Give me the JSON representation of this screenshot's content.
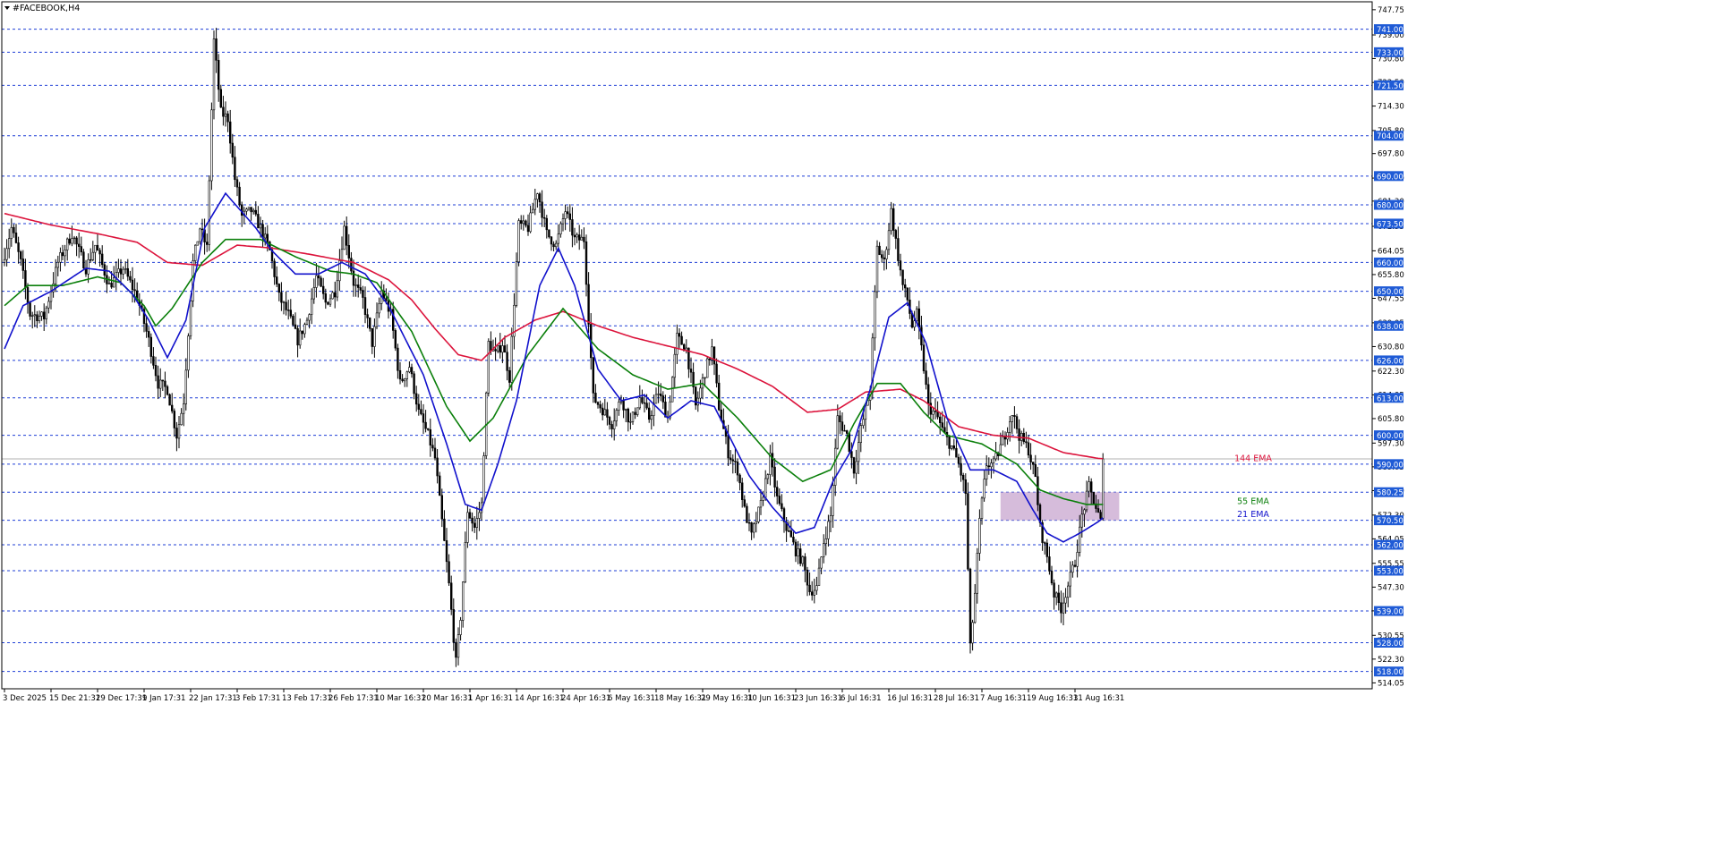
{
  "window": {
    "title": "#FACEBOOK,H4",
    "menu_icon": "triangle-down-icon"
  },
  "colors": {
    "background": "#ffffff",
    "frame": "#000000",
    "grid_level": "#1f3fd6",
    "candle": "#000000",
    "ema144": "#dc143c",
    "ema55": "#0a7f0a",
    "ema21": "#1111cc",
    "zone_fill": "#c8a6cf",
    "price_label_bg": "#1f5bd6",
    "price_label_text": "#ffffff",
    "axis_text": "#000000",
    "bid_line": "#b0b0b0"
  },
  "chart_data": {
    "type": "candlestick",
    "symbol": "#FACEBOOK",
    "timeframe": "H4",
    "ylim": [
      512.0,
      750.5
    ],
    "y_ticks": [
      "747.75",
      "739.00",
      "730.80",
      "722.50",
      "714.30",
      "705.80",
      "697.80",
      "689.30",
      "681.30",
      "672.55",
      "664.05",
      "655.80",
      "647.55",
      "639.05",
      "630.80",
      "622.30",
      "614.05",
      "605.80",
      "597.30",
      "589.05",
      "580.80",
      "572.30",
      "564.05",
      "555.55",
      "547.30",
      "539.05",
      "530.55",
      "522.30",
      "514.05"
    ],
    "x_labels": [
      "3 Dec 2025",
      "15 Dec 21:31",
      "29 Dec 17:31",
      "9 Jan 17:31",
      "22 Jan 17:31",
      "3 Feb 17:31",
      "13 Feb 17:31",
      "26 Feb 17:31",
      "10 Mar 16:31",
      "20 Mar 16:31",
      "1 Apr 16:31",
      "14 Apr 16:31",
      "24 Apr 16:31",
      "6 May 16:31",
      "18 May 16:31",
      "29 May 16:31",
      "10 Jun 16:31",
      "23 Jun 16:31",
      "6 Jul 16:31",
      "16 Jul 16:31",
      "28 Jul 16:31",
      "7 Aug 16:31",
      "19 Aug 16:31",
      "31 Aug 16:31"
    ],
    "x_label_bar_index": [
      0,
      20,
      40,
      60,
      80,
      100,
      120,
      140,
      160,
      180,
      200,
      220,
      240,
      260,
      280,
      300,
      320,
      340,
      360,
      380,
      400,
      420,
      440,
      460
    ],
    "bar_count": 473,
    "horizontal_levels": [
      "741.00",
      "733.00",
      "721.50",
      "704.00",
      "690.00",
      "680.00",
      "673.50",
      "660.00",
      "650.00",
      "638.00",
      "626.00",
      "613.00",
      "600.00",
      "590.00",
      "580.25",
      "570.50",
      "562.00",
      "553.00",
      "539.00",
      "528.00",
      "518.00"
    ],
    "last_price": 591.8,
    "zone": {
      "bar_start": 428,
      "bar_end": 479,
      "low": 570.5,
      "high": 580.25
    },
    "waypoints": [
      [
        0,
        660
      ],
      [
        4,
        672
      ],
      [
        8,
        660
      ],
      [
        12,
        642
      ],
      [
        18,
        641
      ],
      [
        24,
        660
      ],
      [
        30,
        670
      ],
      [
        36,
        658
      ],
      [
        40,
        666
      ],
      [
        46,
        652
      ],
      [
        52,
        658
      ],
      [
        58,
        648
      ],
      [
        63,
        633
      ],
      [
        67,
        618
      ],
      [
        71,
        616
      ],
      [
        75,
        600
      ],
      [
        78,
        612
      ],
      [
        82,
        660
      ],
      [
        85,
        672
      ],
      [
        88,
        665
      ],
      [
        91,
        737
      ],
      [
        94,
        712
      ],
      [
        97,
        710
      ],
      [
        100,
        689
      ],
      [
        103,
        676
      ],
      [
        107,
        678
      ],
      [
        111,
        672
      ],
      [
        115,
        664
      ],
      [
        119,
        648
      ],
      [
        123,
        642
      ],
      [
        127,
        633
      ],
      [
        131,
        640
      ],
      [
        135,
        655
      ],
      [
        139,
        646
      ],
      [
        143,
        650
      ],
      [
        147,
        672
      ],
      [
        151,
        653
      ],
      [
        155,
        647
      ],
      [
        159,
        632
      ],
      [
        163,
        650
      ],
      [
        167,
        642
      ],
      [
        171,
        618
      ],
      [
        175,
        624
      ],
      [
        179,
        608
      ],
      [
        183,
        600
      ],
      [
        186,
        592
      ],
      [
        189,
        570
      ],
      [
        192,
        548
      ],
      [
        195,
        521
      ],
      [
        197,
        537
      ],
      [
        200,
        574
      ],
      [
        203,
        568
      ],
      [
        206,
        576
      ],
      [
        209,
        632
      ],
      [
        212,
        628
      ],
      [
        215,
        632
      ],
      [
        218,
        620
      ],
      [
        222,
        673
      ],
      [
        226,
        672
      ],
      [
        230,
        685
      ],
      [
        234,
        670
      ],
      [
        238,
        666
      ],
      [
        242,
        678
      ],
      [
        246,
        668
      ],
      [
        250,
        668
      ],
      [
        254,
        613
      ],
      [
        258,
        609
      ],
      [
        262,
        604
      ],
      [
        266,
        613
      ],
      [
        270,
        604
      ],
      [
        274,
        613
      ],
      [
        278,
        606
      ],
      [
        282,
        615
      ],
      [
        286,
        606
      ],
      [
        290,
        634
      ],
      [
        294,
        630
      ],
      [
        298,
        610
      ],
      [
        302,
        622
      ],
      [
        305,
        630
      ],
      [
        308,
        610
      ],
      [
        312,
        594
      ],
      [
        316,
        588
      ],
      [
        319,
        574
      ],
      [
        322,
        565
      ],
      [
        326,
        576
      ],
      [
        330,
        592
      ],
      [
        333,
        578
      ],
      [
        337,
        568
      ],
      [
        341,
        560
      ],
      [
        344,
        556
      ],
      [
        347,
        546
      ],
      [
        350,
        547
      ],
      [
        353,
        563
      ],
      [
        356,
        572
      ],
      [
        359,
        606
      ],
      [
        363,
        600
      ],
      [
        366,
        588
      ],
      [
        369,
        602
      ],
      [
        373,
        616
      ],
      [
        376,
        665
      ],
      [
        379,
        660
      ],
      [
        382,
        678
      ],
      [
        385,
        662
      ],
      [
        387,
        652
      ],
      [
        389,
        647
      ],
      [
        391,
        638
      ],
      [
        393,
        642
      ],
      [
        395,
        630
      ],
      [
        398,
        610
      ],
      [
        402,
        606
      ],
      [
        405,
        600
      ],
      [
        408,
        596
      ],
      [
        411,
        590
      ],
      [
        414,
        580
      ],
      [
        416,
        526
      ],
      [
        418,
        545
      ],
      [
        420,
        570
      ],
      [
        423,
        590
      ],
      [
        426,
        590
      ],
      [
        430,
        598
      ],
      [
        434,
        608
      ],
      [
        437,
        600
      ],
      [
        441,
        595
      ],
      [
        444,
        585
      ],
      [
        446,
        568
      ],
      [
        449,
        558
      ],
      [
        452,
        545
      ],
      [
        455,
        540
      ],
      [
        458,
        548
      ],
      [
        461,
        556
      ],
      [
        464,
        572
      ],
      [
        467,
        582
      ],
      [
        470,
        575
      ],
      [
        472,
        570
      ],
      [
        474,
        578
      ],
      [
        476,
        586
      ],
      [
        479,
        591.8
      ]
    ],
    "series": [
      {
        "name": "144 EMA",
        "waypoints": [
          [
            0,
            677
          ],
          [
            20,
            673
          ],
          [
            40,
            670
          ],
          [
            57,
            667
          ],
          [
            70,
            660
          ],
          [
            85,
            659
          ],
          [
            100,
            666
          ],
          [
            115,
            665
          ],
          [
            130,
            663
          ],
          [
            150,
            660
          ],
          [
            165,
            654
          ],
          [
            175,
            647
          ],
          [
            185,
            637
          ],
          [
            195,
            628
          ],
          [
            205,
            626
          ],
          [
            215,
            634
          ],
          [
            228,
            640
          ],
          [
            240,
            643
          ],
          [
            255,
            638
          ],
          [
            270,
            634
          ],
          [
            285,
            631
          ],
          [
            300,
            628
          ],
          [
            315,
            623
          ],
          [
            330,
            617
          ],
          [
            345,
            608
          ],
          [
            358,
            609
          ],
          [
            370,
            615
          ],
          [
            385,
            616
          ],
          [
            395,
            612
          ],
          [
            410,
            603
          ],
          [
            425,
            600
          ],
          [
            440,
            599
          ],
          [
            455,
            594
          ],
          [
            470,
            592
          ],
          [
            479,
            591.5
          ]
        ]
      },
      {
        "name": "55 EMA",
        "waypoints": [
          [
            0,
            645
          ],
          [
            10,
            652
          ],
          [
            25,
            652
          ],
          [
            40,
            655
          ],
          [
            50,
            653
          ],
          [
            60,
            645
          ],
          [
            65,
            638
          ],
          [
            72,
            644
          ],
          [
            85,
            660
          ],
          [
            95,
            668
          ],
          [
            110,
            668
          ],
          [
            125,
            662
          ],
          [
            140,
            657
          ],
          [
            150,
            656
          ],
          [
            160,
            653
          ],
          [
            175,
            636
          ],
          [
            190,
            610
          ],
          [
            200,
            598
          ],
          [
            210,
            606
          ],
          [
            225,
            628
          ],
          [
            240,
            644
          ],
          [
            255,
            630
          ],
          [
            270,
            621
          ],
          [
            285,
            616
          ],
          [
            300,
            618
          ],
          [
            315,
            606
          ],
          [
            330,
            592
          ],
          [
            343,
            584
          ],
          [
            355,
            588
          ],
          [
            365,
            604
          ],
          [
            375,
            618
          ],
          [
            385,
            618
          ],
          [
            395,
            608
          ],
          [
            405,
            600
          ],
          [
            420,
            597
          ],
          [
            435,
            590
          ],
          [
            445,
            581
          ],
          [
            455,
            578
          ],
          [
            465,
            576
          ],
          [
            474,
            576
          ],
          [
            479,
            578
          ]
        ]
      },
      {
        "name": "21 EMA",
        "waypoints": [
          [
            0,
            630
          ],
          [
            8,
            645
          ],
          [
            20,
            650
          ],
          [
            35,
            658
          ],
          [
            45,
            657
          ],
          [
            55,
            649
          ],
          [
            62,
            640
          ],
          [
            70,
            627
          ],
          [
            78,
            640
          ],
          [
            86,
            672
          ],
          [
            95,
            684
          ],
          [
            108,
            672
          ],
          [
            115,
            664
          ],
          [
            125,
            656
          ],
          [
            135,
            656
          ],
          [
            145,
            660
          ],
          [
            155,
            656
          ],
          [
            165,
            645
          ],
          [
            180,
            621
          ],
          [
            190,
            597
          ],
          [
            198,
            576
          ],
          [
            205,
            574
          ],
          [
            212,
            590
          ],
          [
            220,
            612
          ],
          [
            230,
            652
          ],
          [
            238,
            665
          ],
          [
            245,
            652
          ],
          [
            255,
            623
          ],
          [
            265,
            612
          ],
          [
            275,
            614
          ],
          [
            285,
            606
          ],
          [
            295,
            612
          ],
          [
            305,
            610
          ],
          [
            320,
            586
          ],
          [
            330,
            575
          ],
          [
            340,
            566
          ],
          [
            348,
            568
          ],
          [
            356,
            584
          ],
          [
            364,
            595
          ],
          [
            372,
            616
          ],
          [
            380,
            641
          ],
          [
            388,
            646
          ],
          [
            396,
            632
          ],
          [
            405,
            606
          ],
          [
            415,
            588
          ],
          [
            425,
            588
          ],
          [
            435,
            584
          ],
          [
            442,
            574
          ],
          [
            448,
            566
          ],
          [
            455,
            563
          ],
          [
            462,
            566
          ],
          [
            470,
            570
          ],
          [
            476,
            574
          ],
          [
            479,
            577
          ]
        ]
      }
    ],
    "annotations": [
      {
        "text": "144 EMA",
        "color": "#dc143c",
        "price": 592.0
      },
      {
        "text": "55 EMA",
        "color": "#0a7f0a",
        "price": 577.0
      },
      {
        "text": "21 EMA",
        "color": "#1111cc",
        "price": 572.5
      }
    ]
  }
}
